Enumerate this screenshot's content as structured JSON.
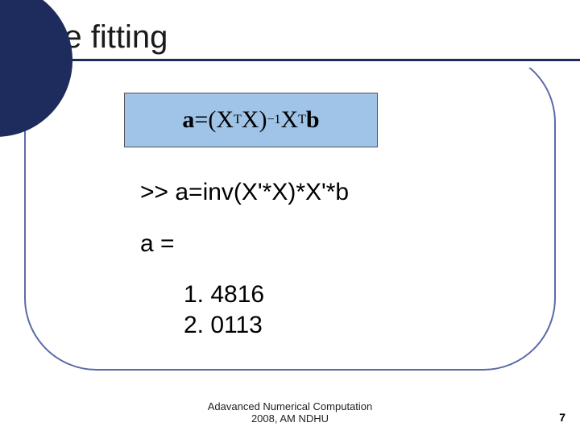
{
  "title": "Line fitting",
  "formula": {
    "left": "a",
    "eq": " = ",
    "open": "(",
    "X1": "X",
    "sup1": "T",
    "X2": "X",
    "close": ")",
    "inv": "−1",
    "X3": "X",
    "sup2": "T",
    "b": "b"
  },
  "code": {
    "command": ">> a=inv(X'*X)*X'*b",
    "var_line": "a =",
    "value1": "1. 4816",
    "value2": "2. 0113"
  },
  "footer": {
    "line1": "Adavanced Numerical Computation",
    "line2": "2008, AM NDHU"
  },
  "page_number": "7"
}
